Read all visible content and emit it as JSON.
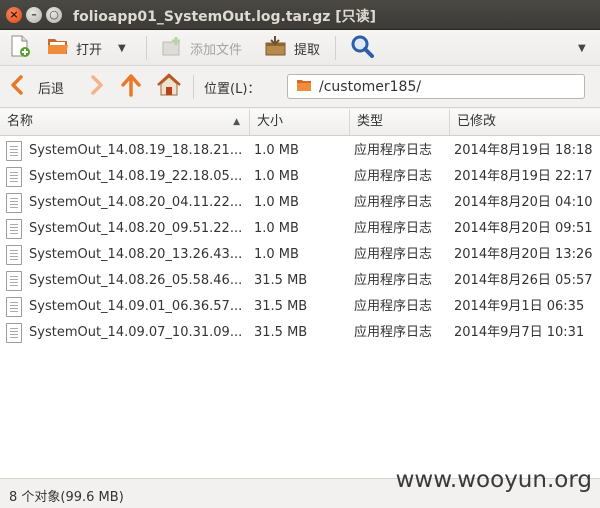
{
  "window": {
    "title": "folioapp01_SystemOut.log.tar.gz [只读]",
    "close_glyph": "×",
    "minimize_glyph": "–",
    "maximize_glyph": "○"
  },
  "toolbar": {
    "new_label": "",
    "open_label": "打开",
    "add_files_label": "添加文件",
    "extract_label": "提取"
  },
  "nav": {
    "back_label": "后退",
    "location_label": "位置(L)：",
    "path": "/customer185/"
  },
  "columns": {
    "name": "名称",
    "size": "大小",
    "type": "类型",
    "modified": "已修改"
  },
  "files": [
    {
      "name": "SystemOut_14.08.19_18.18.21...",
      "size": "1.0 MB",
      "type": "应用程序日志",
      "modified": "2014年8月19日 18:18"
    },
    {
      "name": "SystemOut_14.08.19_22.18.05...",
      "size": "1.0 MB",
      "type": "应用程序日志",
      "modified": "2014年8月19日 22:17"
    },
    {
      "name": "SystemOut_14.08.20_04.11.22...",
      "size": "1.0 MB",
      "type": "应用程序日志",
      "modified": "2014年8月20日 04:10"
    },
    {
      "name": "SystemOut_14.08.20_09.51.22...",
      "size": "1.0 MB",
      "type": "应用程序日志",
      "modified": "2014年8月20日 09:51"
    },
    {
      "name": "SystemOut_14.08.20_13.26.43...",
      "size": "1.0 MB",
      "type": "应用程序日志",
      "modified": "2014年8月20日 13:26"
    },
    {
      "name": "SystemOut_14.08.26_05.58.46...",
      "size": "31.5 MB",
      "type": "应用程序日志",
      "modified": "2014年8月26日 05:57"
    },
    {
      "name": "SystemOut_14.09.01_06.36.57...",
      "size": "31.5 MB",
      "type": "应用程序日志",
      "modified": "2014年9月1日 06:35"
    },
    {
      "name": "SystemOut_14.09.07_10.31.09...",
      "size": "31.5 MB",
      "type": "应用程序日志",
      "modified": "2014年9月7日 10:31"
    }
  ],
  "status": {
    "text": "8 个对象(99.6 MB)",
    "watermark": "www.wooyun.org"
  },
  "colors": {
    "accent_orange": "#e9792a",
    "search_blue": "#2d5ea8"
  }
}
